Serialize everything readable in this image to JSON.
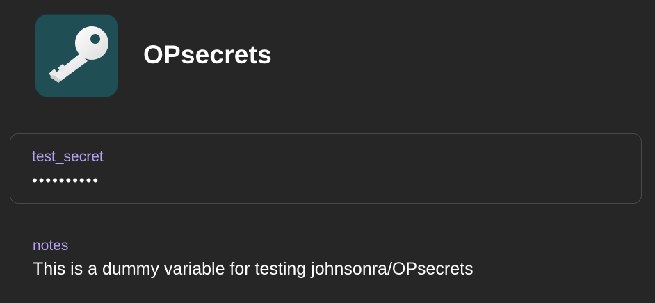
{
  "header": {
    "icon": "key-icon",
    "title": "OPsecrets",
    "icon_bg_color": "#1f4e55"
  },
  "secret_field": {
    "label": "test_secret",
    "value_masked": "••••••••••"
  },
  "notes": {
    "label": "notes",
    "value": "This is a dummy variable for testing johnsonra/OPsecrets"
  },
  "colors": {
    "background": "#262626",
    "label_accent": "#b7a3f5",
    "text": "#ffffff",
    "card_border": "#494949"
  }
}
